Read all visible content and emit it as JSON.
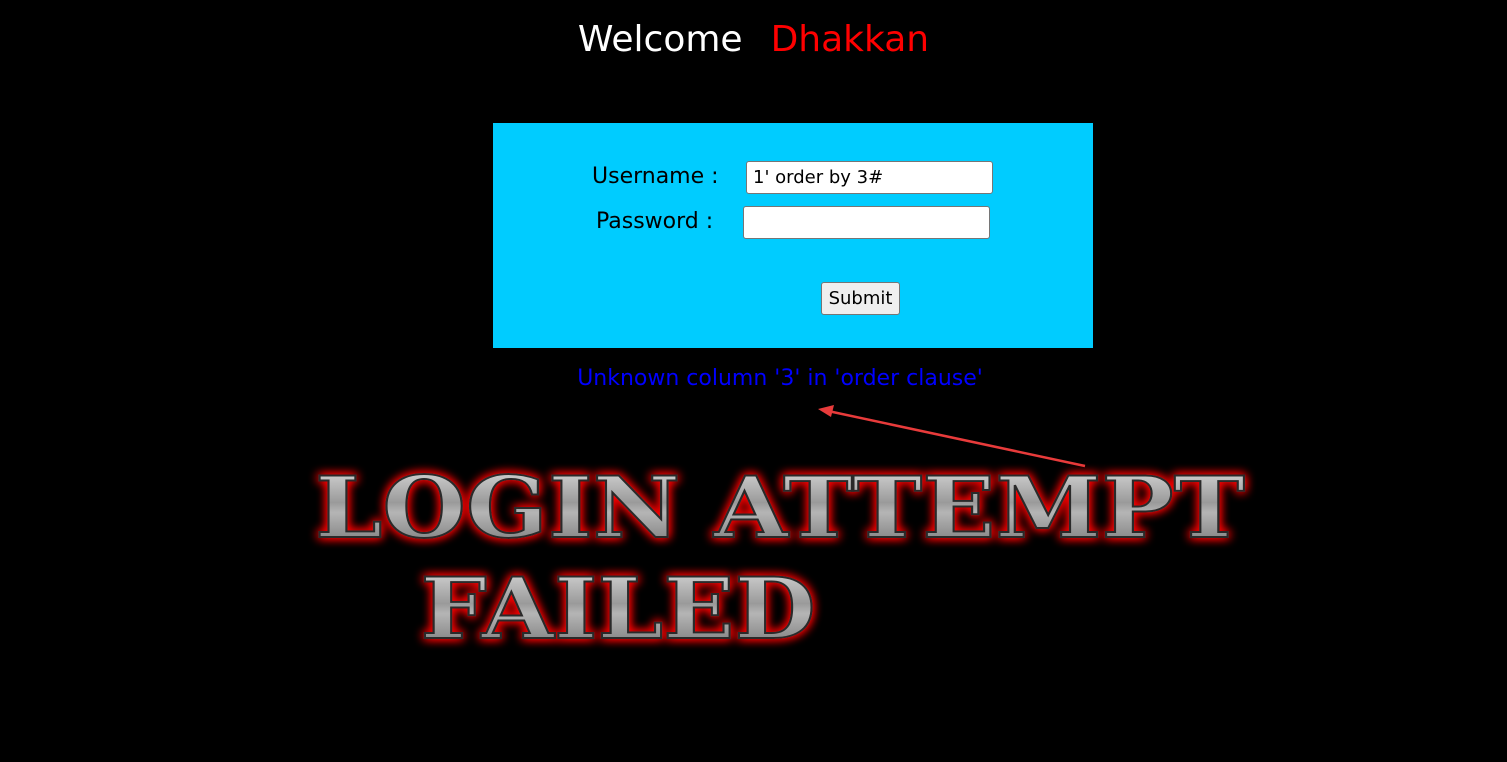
{
  "header": {
    "welcome": "Welcome",
    "name": "Dhakkan"
  },
  "form": {
    "username_label": "Username :",
    "password_label": "Password :",
    "username_value": "1' order by 3#",
    "password_value": "",
    "submit_label": "Submit"
  },
  "result": {
    "error_message": "Unknown column '3' in 'order clause'"
  },
  "banner": {
    "line1": "LOGIN ATTEMPT",
    "line2": "FAILED"
  },
  "colors": {
    "background": "#000000",
    "panel": "#00ccff",
    "name": "#ff0000",
    "error": "#0000ff",
    "arrow": "#e83b3b",
    "banner_glow": "#ff0000"
  }
}
